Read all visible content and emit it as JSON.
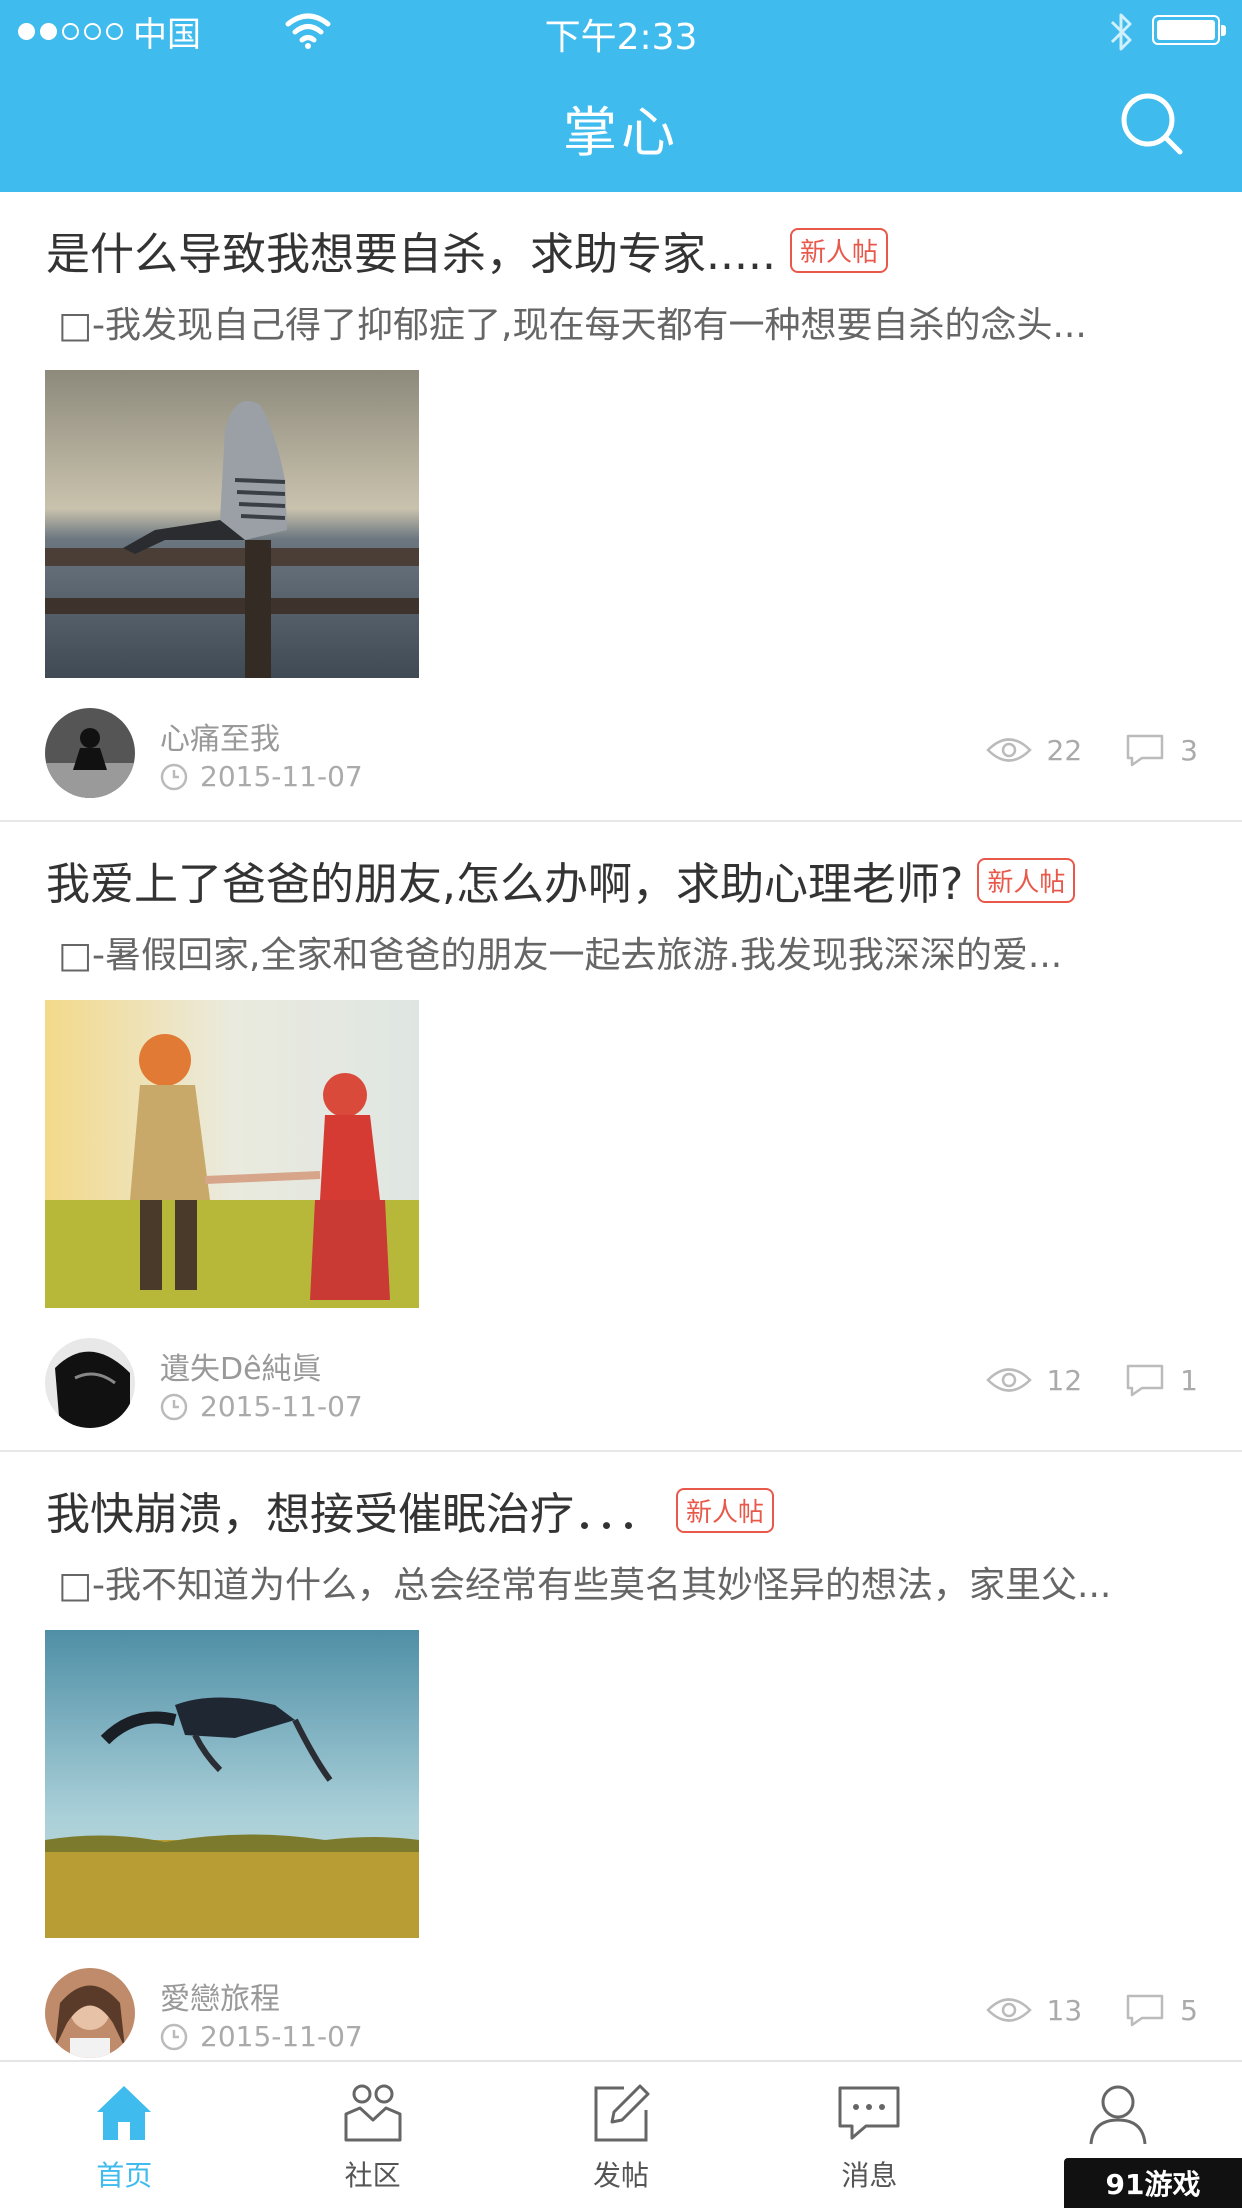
{
  "statusbar": {
    "carrier": "中国",
    "time": "下午2:33"
  },
  "header": {
    "title": "掌心",
    "search_icon": "search-icon"
  },
  "posts": [
    {
      "title": "是什么导致我想要自杀，求助专家.....",
      "tag": "新人帖",
      "excerpt": "□-我发现自己得了抑郁症了,现在每天都有一种想要自杀的念头...",
      "author": "心痛至我",
      "date": "2015-11-07",
      "views": "22",
      "comments": "3"
    },
    {
      "title": "我爱上了爸爸的朋友,怎么办啊，求助心理老师?",
      "tag": "新人帖",
      "excerpt": "□-暑假回家,全家和爸爸的朋友一起去旅游.我发现我深深的爱...",
      "author": "遺失Dê純眞",
      "date": "2015-11-07",
      "views": "12",
      "comments": "1"
    },
    {
      "title": "我快崩溃，想接受催眠治疗．．．",
      "tag": "新人帖",
      "excerpt": "□-我不知道为什么，总会经常有些莫名其妙怪异的想法，家里父...",
      "author": "愛戀旅程",
      "date": "2015-11-07",
      "views": "13",
      "comments": "5"
    }
  ],
  "tabs": [
    {
      "label": "首页",
      "icon": "home-icon",
      "active": true
    },
    {
      "label": "社区",
      "icon": "community-icon",
      "active": false
    },
    {
      "label": "发帖",
      "icon": "compose-icon",
      "active": false
    },
    {
      "label": "消息",
      "icon": "message-icon",
      "active": false
    },
    {
      "label": "",
      "icon": "profile-icon",
      "active": false
    }
  ],
  "watermark": "91游戏",
  "colors": {
    "accent": "#3fbbee",
    "tag": "#e8594b"
  }
}
